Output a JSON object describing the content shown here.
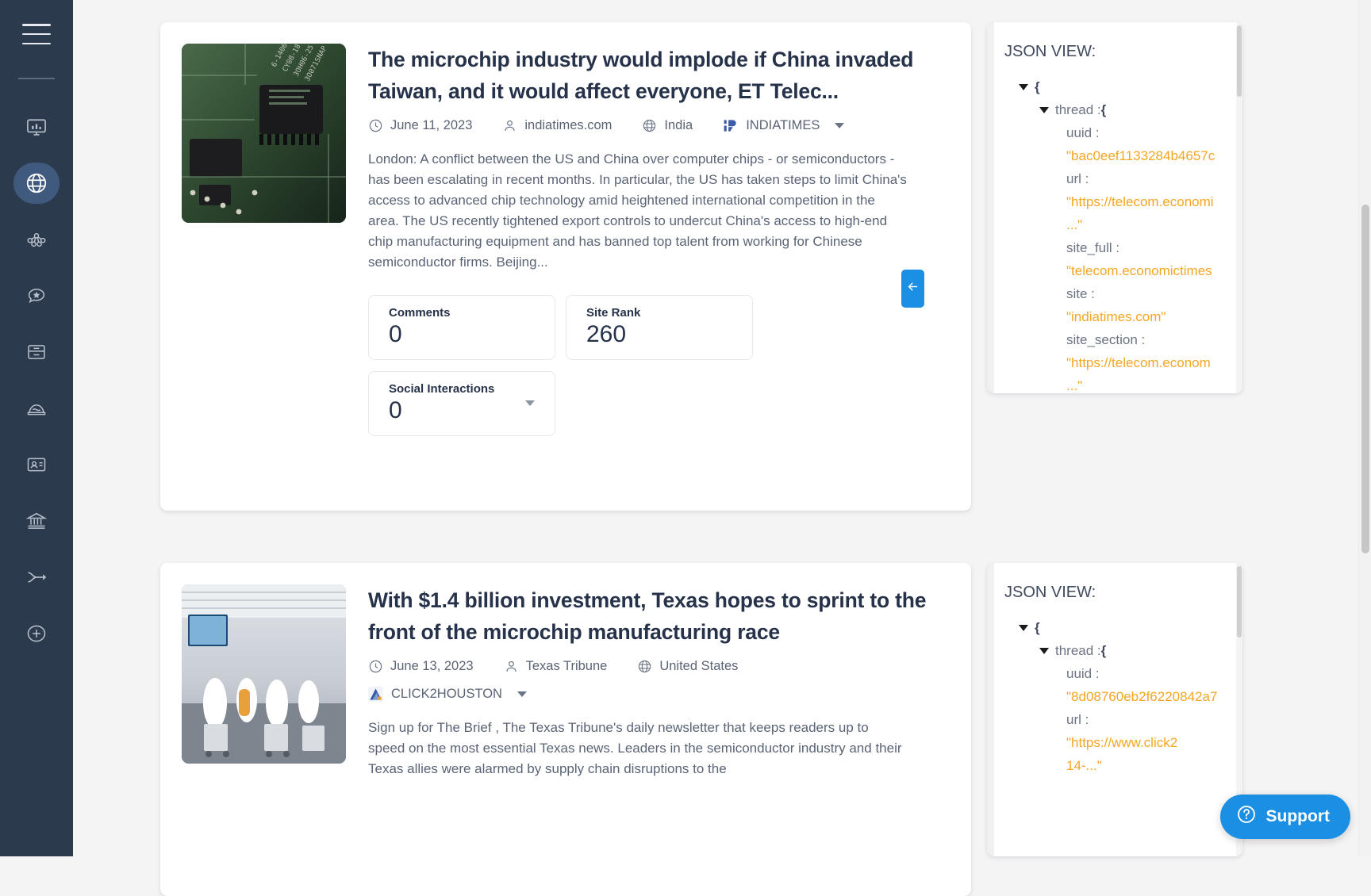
{
  "sidebar": {
    "menu_icon": "hamburger-icon",
    "items": [
      {
        "icon": "dashboard-monitor-icon",
        "label": "Dashboard",
        "active": false
      },
      {
        "icon": "globe-icon",
        "label": "Web Search",
        "active": true
      },
      {
        "icon": "network-nodes-icon",
        "label": "Network",
        "active": false
      },
      {
        "icon": "star-review-icon",
        "label": "Reviews",
        "active": false
      },
      {
        "icon": "archive-box-icon",
        "label": "Archive",
        "active": false
      },
      {
        "icon": "cake-layers-icon",
        "label": "Datasets",
        "active": false
      },
      {
        "icon": "id-badge-icon",
        "label": "Profiles",
        "active": false
      },
      {
        "icon": "bank-building-icon",
        "label": "Finance",
        "active": false
      },
      {
        "icon": "merge-arrow-icon",
        "label": "Streams",
        "active": false
      },
      {
        "icon": "plus-circle-icon",
        "label": "Add",
        "active": false
      }
    ]
  },
  "articles": [
    {
      "title": "The microchip industry would implode if China invaded Taiwan, and it would affect everyone, ET Telec...",
      "meta": {
        "date": "June 11, 2023",
        "author": "indiatimes.com",
        "country": "India",
        "source": "INDIATIMES"
      },
      "excerpt": "London: A conflict between the US and China over computer chips - or semiconductors - has been escalating in recent months. In particular, the US has taken steps to limit China's access to advanced chip technology amid heightened international competition in the area. The US recently tightened export controls to undercut China's access to high-end chip manufacturing equipment and has banned top talent from working for Chinese semiconductor firms. Beijing...",
      "stats": [
        {
          "label": "Comments",
          "value": "0",
          "has_caret": false
        },
        {
          "label": "Site Rank",
          "value": "260",
          "has_caret": false
        },
        {
          "label": "Social Interactions",
          "value": "0",
          "has_caret": true
        }
      ]
    },
    {
      "title": "With $1.4 billion investment, Texas hopes to sprint to the front of the microchip manufacturing race",
      "meta": {
        "date": "June 13, 2023",
        "author": "Texas Tribune",
        "country": "United States",
        "source": "CLICK2HOUSTON"
      },
      "excerpt": "Sign up for The Brief , The Texas Tribune's daily newsletter that keeps readers up to speed on the most essential Texas news. Leaders in the semiconductor industry and their Texas allies were alarmed by supply chain disruptions to the"
    }
  ],
  "json_panels": [
    {
      "title": "JSON VIEW:",
      "lines": [
        {
          "indent": 1,
          "triangle": true,
          "key": "",
          "sep": "",
          "value": "{",
          "kind": "brace"
        },
        {
          "indent": 2,
          "triangle": true,
          "key": "thread",
          "sep": ":",
          "value": "{",
          "kind": "brace"
        },
        {
          "indent": 3,
          "triangle": false,
          "key": "uuid",
          "sep": ":",
          "value": "",
          "kind": "key"
        },
        {
          "indent": 3,
          "triangle": false,
          "key": "",
          "sep": "",
          "value": "\"bac0eef1133284b4657c",
          "kind": "value"
        },
        {
          "indent": 3,
          "triangle": false,
          "key": "url",
          "sep": ":",
          "value": "",
          "kind": "key"
        },
        {
          "indent": 3,
          "triangle": false,
          "key": "",
          "sep": "",
          "value": "\"https://telecom.economi",
          "kind": "value"
        },
        {
          "indent": 3,
          "triangle": false,
          "key": "",
          "sep": "",
          "value": "...\"",
          "kind": "value"
        },
        {
          "indent": 3,
          "triangle": false,
          "key": "site_full",
          "sep": ":",
          "value": "",
          "kind": "key"
        },
        {
          "indent": 3,
          "triangle": false,
          "key": "",
          "sep": "",
          "value": "\"telecom.economictimes",
          "kind": "value"
        },
        {
          "indent": 3,
          "triangle": false,
          "key": "site",
          "sep": ":",
          "value": "",
          "kind": "key"
        },
        {
          "indent": 3,
          "triangle": false,
          "key": "",
          "sep": "",
          "value": "\"indiatimes.com\"",
          "kind": "value"
        },
        {
          "indent": 3,
          "triangle": false,
          "key": "site_section",
          "sep": ":",
          "value": "",
          "kind": "key"
        },
        {
          "indent": 3,
          "triangle": false,
          "key": "",
          "sep": "",
          "value": "\"https://telecom.econom",
          "kind": "value"
        },
        {
          "indent": 3,
          "triangle": false,
          "key": "",
          "sep": "",
          "value": "...\"",
          "kind": "value"
        }
      ]
    },
    {
      "title": "JSON VIEW:",
      "lines": [
        {
          "indent": 1,
          "triangle": true,
          "key": "",
          "sep": "",
          "value": "{",
          "kind": "brace"
        },
        {
          "indent": 2,
          "triangle": true,
          "key": "thread",
          "sep": ":",
          "value": "{",
          "kind": "brace"
        },
        {
          "indent": 3,
          "triangle": false,
          "key": "uuid",
          "sep": ":",
          "value": "",
          "kind": "key"
        },
        {
          "indent": 3,
          "triangle": false,
          "key": "",
          "sep": "",
          "value": "\"8d08760eb2f6220842a7",
          "kind": "value"
        },
        {
          "indent": 3,
          "triangle": false,
          "key": "url",
          "sep": ":",
          "value": "",
          "kind": "key"
        },
        {
          "indent": 3,
          "triangle": false,
          "key": "",
          "sep": "",
          "value": "\"https://www.click2",
          "kind": "value"
        },
        {
          "indent": 3,
          "triangle": false,
          "key": "",
          "sep": "",
          "value": "14-...\"",
          "kind": "value"
        }
      ]
    }
  ],
  "collapse_tab": {
    "icon": "arrow-left-icon"
  },
  "support": {
    "label": "Support",
    "icon": "question-circle-icon"
  },
  "colors": {
    "sidebar_bg": "#2b3a4d",
    "sidebar_active": "#3f5a7d",
    "page_bg": "#f4f4f5",
    "card_bg": "#ffffff",
    "title_text": "#26324a",
    "muted_text": "#5a6475",
    "json_value": "#f5a623",
    "accent_blue": "#1a8fe3"
  }
}
